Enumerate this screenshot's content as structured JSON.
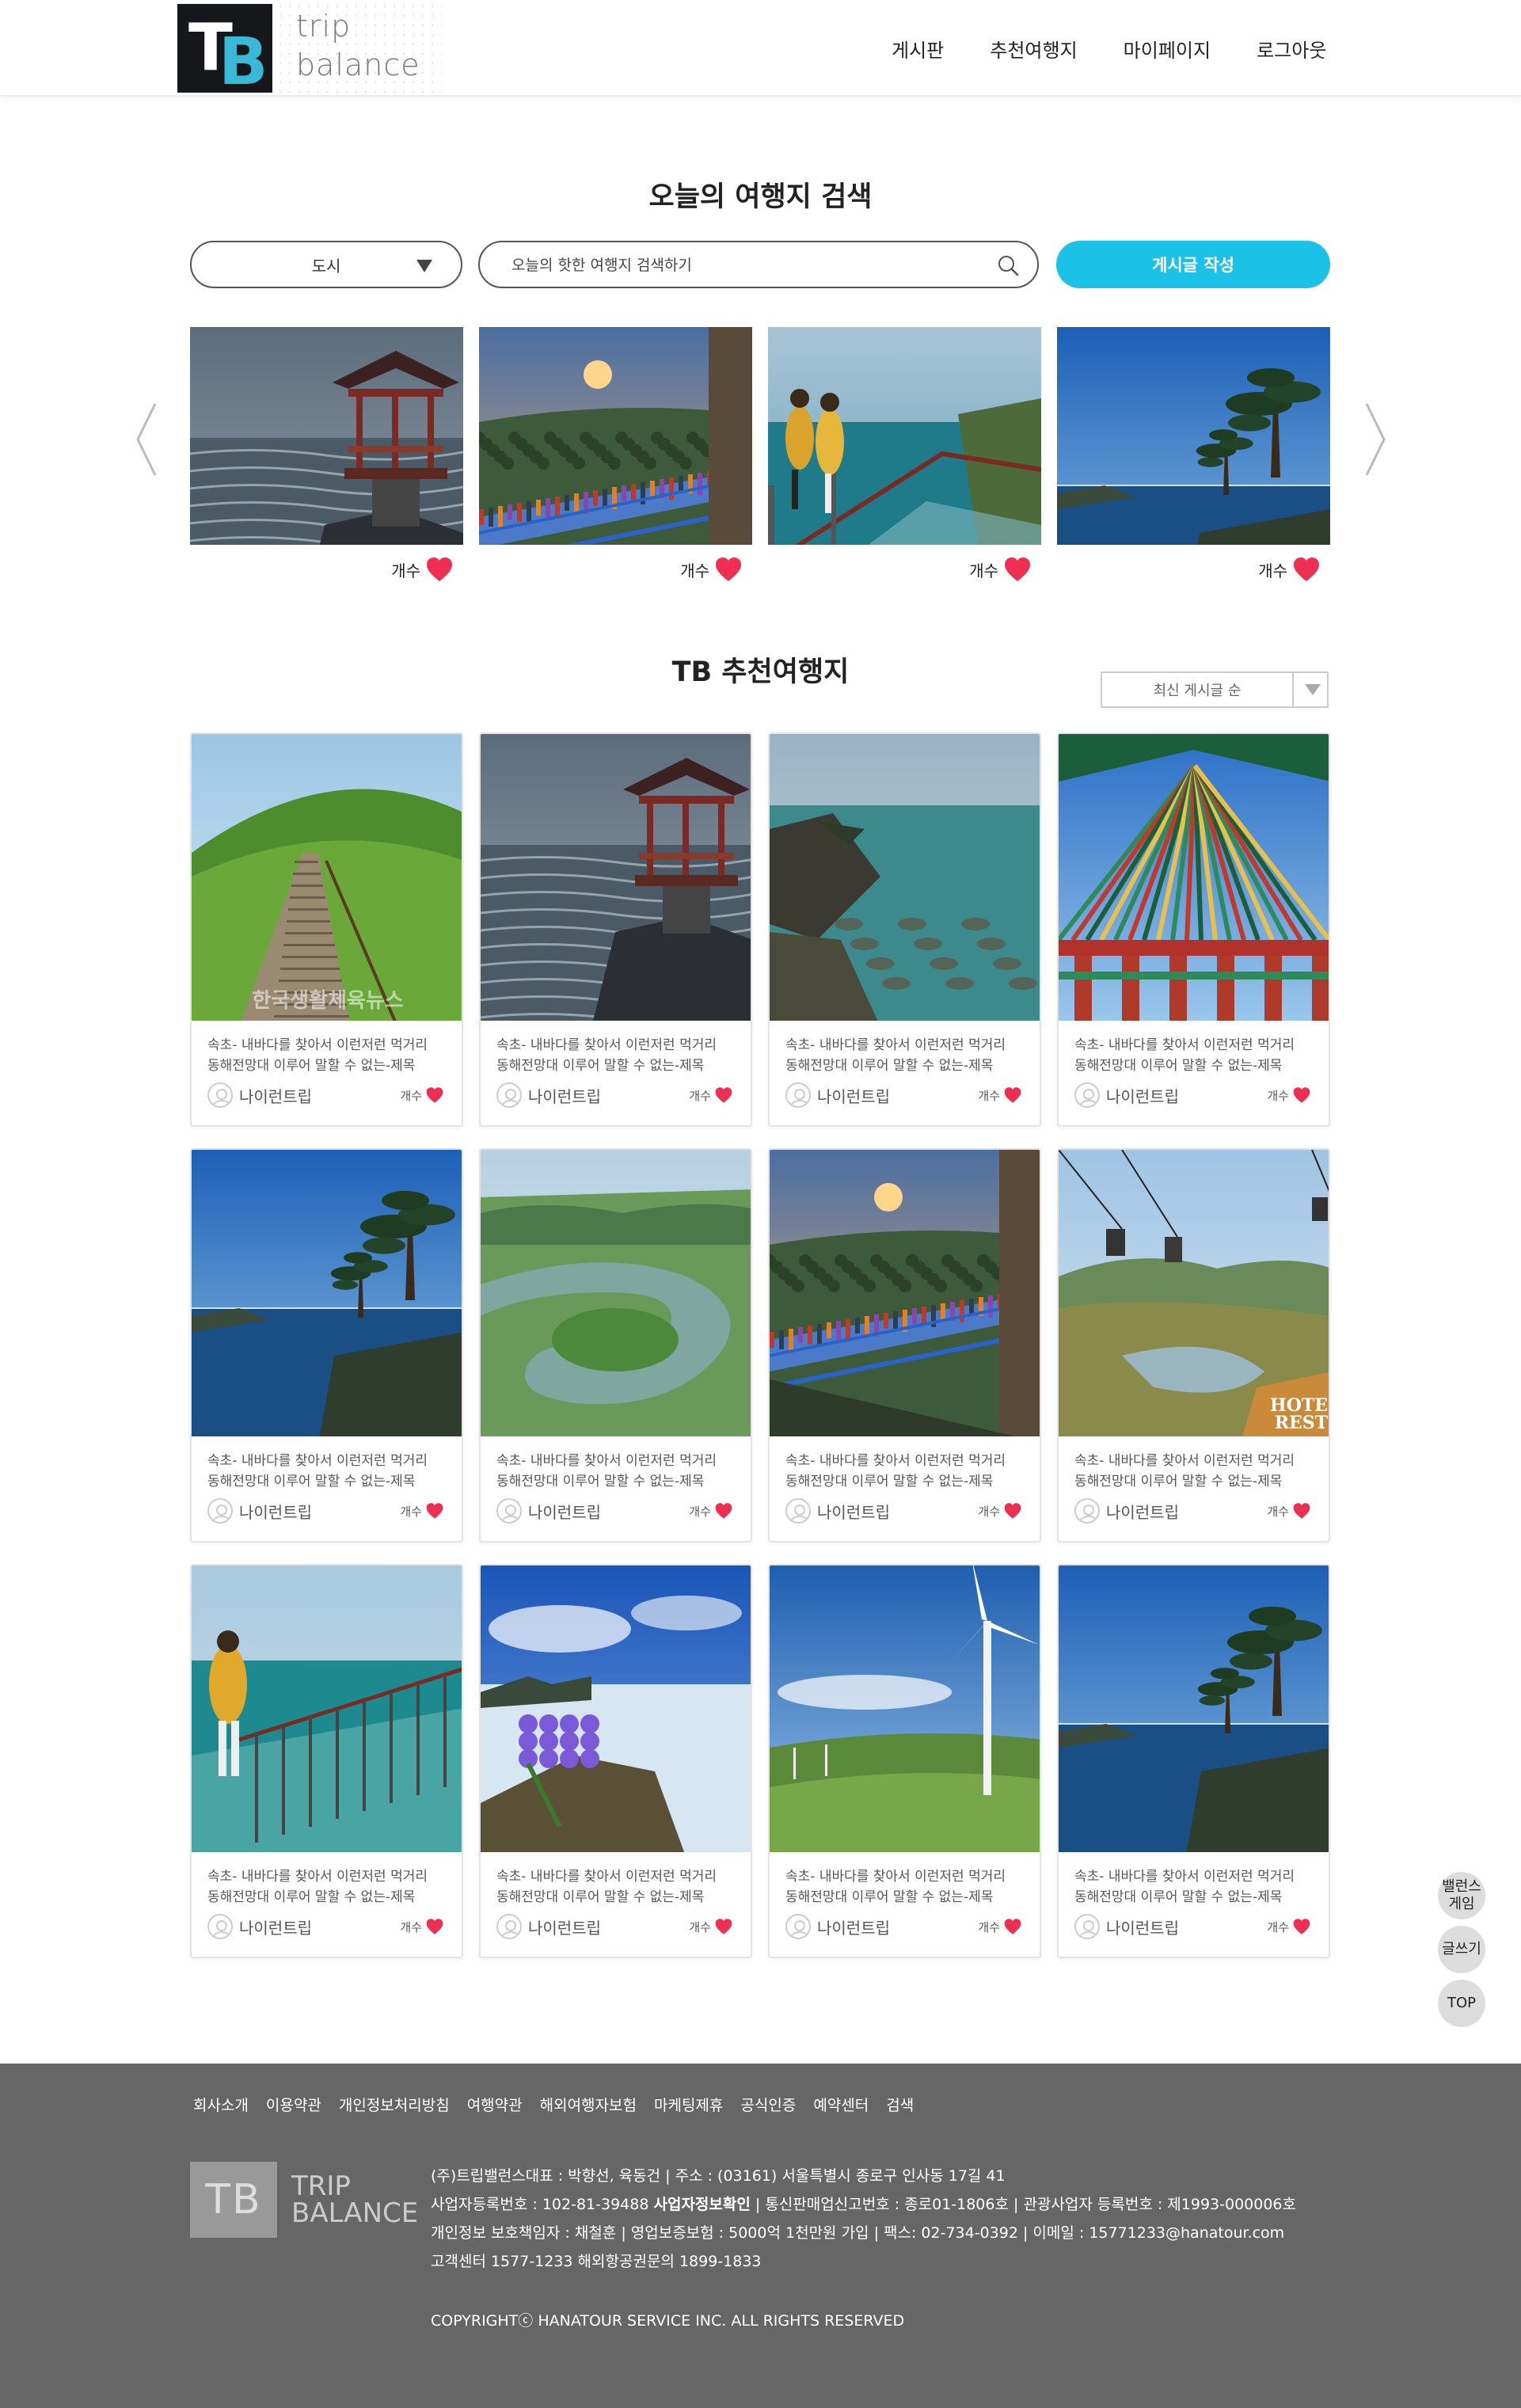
{
  "brand": {
    "logo_mark": "TB",
    "line1": "trip",
    "line2": "balance"
  },
  "nav": [
    "게시판",
    "추천여행지",
    "마이페이지",
    "로그아웃"
  ],
  "search": {
    "title": "오늘의 여행지 검색",
    "city_label": "도시",
    "placeholder": "오늘의 핫한 여행지 검색하기",
    "write_button": "게시글 작성"
  },
  "carousel": {
    "items": [
      {
        "image": "pavilion-sea",
        "like_label": "개수"
      },
      {
        "image": "suspension-bridge",
        "like_label": "개수"
      },
      {
        "image": "skywalk-people",
        "like_label": "개수"
      },
      {
        "image": "coast-pine",
        "like_label": "개수"
      }
    ]
  },
  "recommend": {
    "title": "TB 추천여행지",
    "sort_label": "최신 게시글 순",
    "cards": [
      {
        "image": "green-hill-stairs",
        "desc1": "속초- 내바다를 찾아서 이런저런 먹거리",
        "desc2": "동해전망대 이루어 말할 수 없는-제목",
        "author": "나이런트립",
        "count": "개수"
      },
      {
        "image": "pavilion-sea",
        "desc1": "속초- 내바다를 찾아서 이런저런 먹거리",
        "desc2": "동해전망대 이루어 말할 수 없는-제목",
        "author": "나이런트립",
        "count": "개수"
      },
      {
        "image": "rocky-coast",
        "desc1": "속초- 내바다를 찾아서 이런저런 먹거리",
        "desc2": "동해전망대 이루어 말할 수 없는-제목",
        "author": "나이런트립",
        "count": "개수"
      },
      {
        "image": "temple-roof",
        "desc1": "속초- 내바다를 찾아서 이런저런 먹거리",
        "desc2": "동해전망대 이루어 말할 수 없는-제목",
        "author": "나이런트립",
        "count": "개수"
      },
      {
        "image": "coast-pine",
        "desc1": "속초- 내바다를 찾아서 이런저런 먹거리",
        "desc2": "동해전망대 이루어 말할 수 없는-제목",
        "author": "나이런트립",
        "count": "개수"
      },
      {
        "image": "river-bend",
        "desc1": "속초- 내바다를 찾아서 이런저런 먹거리",
        "desc2": "동해전망대 이루어 말할 수 없는-제목",
        "author": "나이런트립",
        "count": "개수"
      },
      {
        "image": "suspension-bridge",
        "desc1": "속초- 내바다를 찾아서 이런저런 먹거리",
        "desc2": "동해전망대 이루어 말할 수 없는-제목",
        "author": "나이런트립",
        "count": "개수"
      },
      {
        "image": "zipline-valley",
        "desc1": "속초- 내바다를 찾아서 이런저런 먹거리",
        "desc2": "동해전망대 이루어 말할 수 없는-제목",
        "author": "나이런트립",
        "count": "개수"
      },
      {
        "image": "skywalk-person",
        "desc1": "속초- 내바다를 찾아서 이런저런 먹거리",
        "desc2": "동해전망대 이루어 말할 수 없는-제목",
        "author": "나이런트립",
        "count": "개수"
      },
      {
        "image": "flowers-rock",
        "desc1": "속초- 내바다를 찾아서 이런저런 먹거리",
        "desc2": "동해전망대 이루어 말할 수 없는-제목",
        "author": "나이런트립",
        "count": "개수"
      },
      {
        "image": "wind-turbine",
        "desc1": "속초- 내바다를 찾아서 이런저런 먹거리",
        "desc2": "동해전망대 이루어 말할 수 없는-제목",
        "author": "나이런트립",
        "count": "개수"
      },
      {
        "image": "coast-pine",
        "desc1": "속초- 내바다를 찾아서 이런저런 먹거리",
        "desc2": "동해전망대 이루어 말할 수 없는-제목",
        "author": "나이런트립",
        "count": "개수"
      }
    ]
  },
  "floating": {
    "game": "밸런스\n게임",
    "write": "글쓰기",
    "top": "TOP"
  },
  "footer": {
    "links": [
      "회사소개",
      "이용약관",
      "개인정보처리방침",
      "여행약관",
      "해외여행자보험",
      "마케팅제휴",
      "공식인증",
      "예약센터",
      "검색"
    ],
    "logo_mark": "TB",
    "logo_line1": "TRIP",
    "logo_line2": "BALANCE",
    "info1": "(주)트립밸런스대표 : 박향선, 육동건 | 주소 : (03161) 서울특별시 종로구 인사동 17길 41",
    "info2_a": "사업자등록번호 : 102-81-39488 ",
    "info2_b": "사업자정보확인",
    "info2_c": " | 통신판매업신고번호 : 종로01-1806호 | 관광사업자 등록번호 : 제1993-000006호",
    "info3": "개인정보 보호책임자 : 채철훈 | 영업보증보험 : 5000억 1천만원 가입 | 팩스: 02-734-0392 | 이메일 : 15771233@hanatour.com",
    "info4": "고객센터 1577-1233    해외항공권문의 1899-1833",
    "copyright": "COPYRIGHTⓒ HANATOUR SERVICE INC. ALL RIGHTS RESERVED"
  },
  "colors": {
    "accent": "#1bc1e6",
    "heart": "#ee2f53",
    "footer_bg": "#666666"
  }
}
